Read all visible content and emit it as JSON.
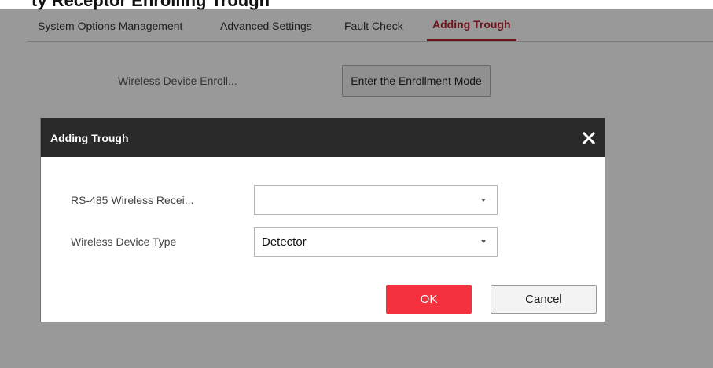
{
  "page": {
    "title": "ty Receptor Enrolling Trough"
  },
  "tabs": [
    {
      "label": "System Options Management",
      "active": false
    },
    {
      "label": "Advanced Settings",
      "active": false
    },
    {
      "label": "Fault Check",
      "active": false
    },
    {
      "label": "Adding Trough",
      "active": true
    }
  ],
  "enrollment": {
    "label": "Wireless Device Enroll...",
    "button_label": "Enter the Enrollment Mode"
  },
  "dialog": {
    "title": "Adding Trough",
    "close_icon": "close-icon",
    "fields": [
      {
        "label": "RS-485 Wireless Recei...",
        "value": ""
      },
      {
        "label": "Wireless Device Type",
        "value": "Detector"
      }
    ],
    "ok_label": "OK",
    "cancel_label": "Cancel"
  },
  "colors": {
    "accent": "#b8202a",
    "ok_button": "#f5303f",
    "dialog_header": "#2a2a2a"
  }
}
